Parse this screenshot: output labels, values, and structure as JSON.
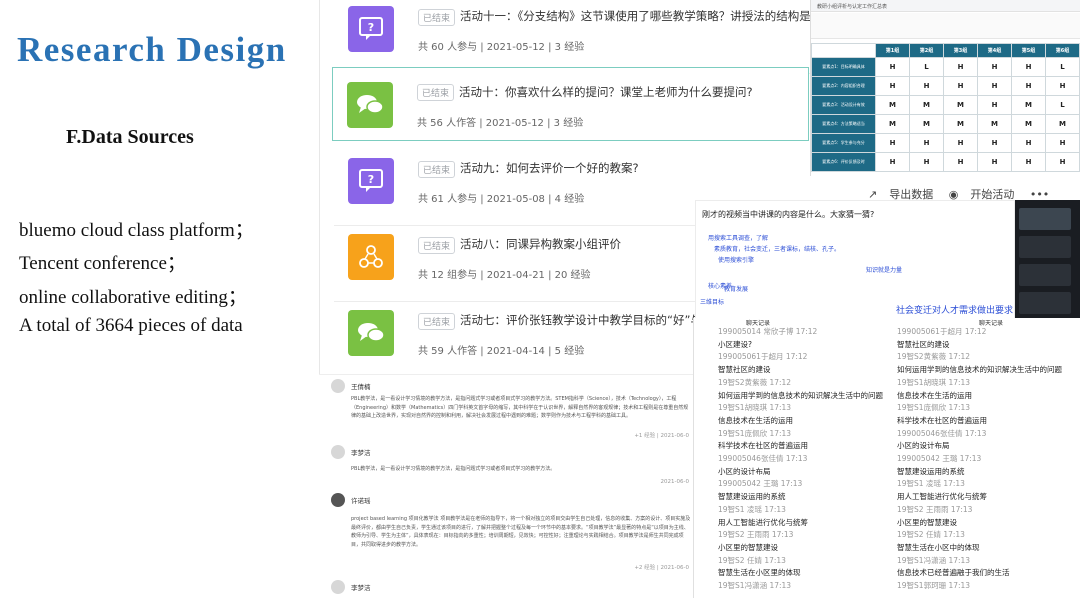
{
  "slide": {
    "title": "Research Design",
    "subtitle": "F.Data Sources",
    "sources": [
      "bluemo cloud class platform；",
      "Tencent conference；",
      "online collaborative editing；",
      "A total of 3664 pieces of data"
    ]
  },
  "activities": [
    {
      "badge": "已结束",
      "title": "活动十一：《分支结构》这节课使用了哪些教学策略？讲授法的结构是如何体现",
      "meta": "共 60 人参与  |  2021-05-12  |  3 经验",
      "icon": "question-icon",
      "color": "#8a65e8"
    },
    {
      "badge": "已结束",
      "title": "活动十：你喜欢什么样的提问？课堂上老师为什么要提问?",
      "meta": "共 56 人作答  |  2021-05-12  |  3 经验",
      "icon": "chat-bubbles-icon",
      "color": "#7ac143"
    },
    {
      "badge": "已结束",
      "title": "活动九：如何去评价一个好的教案?",
      "meta": "共 61 人参与  |  2021-05-08  |  4 经验",
      "icon": "question-icon",
      "color": "#8a65e8"
    },
    {
      "badge": "已结束",
      "title": "活动八：同课异构教案小组评价",
      "meta": "共 12 组参与  |  2021-04-21  |  20 经验",
      "icon": "group-icon",
      "color": "#f7a21b"
    },
    {
      "badge": "已结束",
      "title": "活动七：评价张钰教学设计中教学目标的“好”与“",
      "meta": "共 59 人作答  |  2021-04-14  |  5 经验",
      "icon": "chat-bubbles-icon",
      "color": "#7ac143"
    }
  ],
  "sheet": {
    "doc_title": "教研小组评析与认定工作汇总表",
    "headers": [
      "第1组",
      "第2组",
      "第3组",
      "第4组",
      "第5组",
      "第6组"
    ],
    "rows": [
      {
        "label": "要素点1：目标明确具体",
        "values": [
          "H",
          "L",
          "H",
          "H",
          "H",
          "L"
        ]
      },
      {
        "label": "要素点2：内容组织合理",
        "values": [
          "H",
          "H",
          "H",
          "H",
          "H",
          "H"
        ]
      },
      {
        "label": "要素点3：活动设计有效",
        "values": [
          "M",
          "M",
          "M",
          "H",
          "M",
          "L"
        ]
      },
      {
        "label": "要素点4：方法策略适当",
        "values": [
          "M",
          "M",
          "M",
          "M",
          "M",
          "M"
        ]
      },
      {
        "label": "要素点5：学生参与充分",
        "values": [
          "H",
          "H",
          "H",
          "H",
          "H",
          "H"
        ]
      },
      {
        "label": "要素点6：评价反馈及时",
        "values": [
          "H",
          "H",
          "H",
          "H",
          "H",
          "H"
        ]
      }
    ],
    "actions": {
      "export": "导出数据",
      "start": "开始活动",
      "more": "•••"
    }
  },
  "meeting": {
    "question": "刚才的视频当中讲课的内容是什么。大家猜一猜?",
    "links": [
      "用搜索工具调查，了解",
      "素质教育，社会变迁，三者课标，结核、孔子。",
      "使用搜索引擎",
      "核心素养",
      "教育发展",
      "知识就是力量",
      "三维目标"
    ],
    "banner": "社会变迁对人才需求做出要求"
  },
  "chat": {
    "header": "聊天记录",
    "left": [
      {
        "meta": "199005014 常欣子博 17:12",
        "msg": "小区建设?"
      },
      {
        "meta": "199005061于超月 17:12",
        "msg": "智慧社区的建设"
      },
      {
        "meta": "19智S2黄紫薇 17:12",
        "msg": "如何运用学到的信息技术的知识解决生活中的问题"
      },
      {
        "meta": "19智S1胡晓琪 17:13",
        "msg": "信息技术在生活的运用"
      },
      {
        "meta": "19智S1庞佩欣 17:13",
        "msg": "科学技术在社区的普遍运用"
      },
      {
        "meta": "199005046张佳倩 17:13",
        "msg": "小区的设计布局"
      },
      {
        "meta": "199005042 王璐 17:13",
        "msg": "智慧建设运用的系统"
      },
      {
        "meta": "19智S1 凌瑶 17:13",
        "msg": "用人工智能进行优化与统筹"
      },
      {
        "meta": "19智S2 王雨雨 17:13",
        "msg": "小区里的智慧建设"
      },
      {
        "meta": "19智S2 任婧 17:13",
        "msg": "智慧生活在小区里的体现"
      },
      {
        "meta": "19智S1冯潇涵 17:13",
        "msg": ""
      }
    ],
    "right": [
      {
        "meta": "199005061于超月 17:12",
        "msg": "智慧社区的建设"
      },
      {
        "meta": "19智S2黄紫薇 17:12",
        "msg": "如何运用学到的信息技术的知识解决生活中的问题"
      },
      {
        "meta": "19智S1胡晓琪 17:13",
        "msg": "信息技术在生活的运用"
      },
      {
        "meta": "19智S1庞佩欣 17:13",
        "msg": "科学技术在社区的普遍运用"
      },
      {
        "meta": "199005046张佳倩 17:13",
        "msg": "小区的设计布局"
      },
      {
        "meta": "199005042 王璐 17:13",
        "msg": "智慧建设运用的系统"
      },
      {
        "meta": "19智S1 凌瑶 17:13",
        "msg": "用人工智能进行优化与统筹"
      },
      {
        "meta": "19智S2 王雨雨 17:13",
        "msg": "小区里的智慧建设"
      },
      {
        "meta": "19智S2 任婧 17:13",
        "msg": "智慧生活在小区中的体现"
      },
      {
        "meta": "19智S1冯潇涵 17:13",
        "msg": "信息技术已经普遍融于我们的生活"
      },
      {
        "meta": "19智S1郭珂珊 17:13",
        "msg": ""
      }
    ]
  },
  "forum": [
    {
      "name": "王倩楠",
      "body": "PBL教学法，是一看设计学习情境的教学方法，是指问题式学习或者项目式学习的教学方法。STEM指科学（Science），技术（Technology），工程（Engineering）和数学（Mathematics）四门学科英文首字母的缩写，其中科学在于认识世界，解释自然界的客观规律；技术和工程则是在尊重自然规律的基础上改造世界，实现对自然界的控制和利用，解决社会发展过程中遇到的难题；数学则作为技术与工程学科的基础工具。",
      "foot": "+1 经验  |  2021-06-0"
    },
    {
      "name": "李梦洁",
      "body": "PBL教学法，是一看设计学习情境的教学方法，是指问题式学习或者项目式学习的教学方法。",
      "foot": "2021-06-0"
    },
    {
      "name": "许诺瑶",
      "body": "project based learning 项目化教学法 项目教学法是在老师的指导下，将一个相对独立的项目交由学生自己处理，信息的收集、方案的设计、项目实施及最终评价，都由学生自己负责，学生通过该项目的进行，了解并把握整个过程及每一个环节中的基本要求。“项目教学法”最显著的特点是“以项目为主线、教师为引导、学生为主体”，具体表现在：目标指向的多重性；培训周期短，见效快；可控性好；注重理论与实践相结合。项目教学法是师生共同完成项目，共同取得进步的教学方法。",
      "foot": "+2 经验  |  2021-06-0"
    },
    {
      "name": "李梦洁",
      "body": "",
      "foot": ""
    }
  ]
}
